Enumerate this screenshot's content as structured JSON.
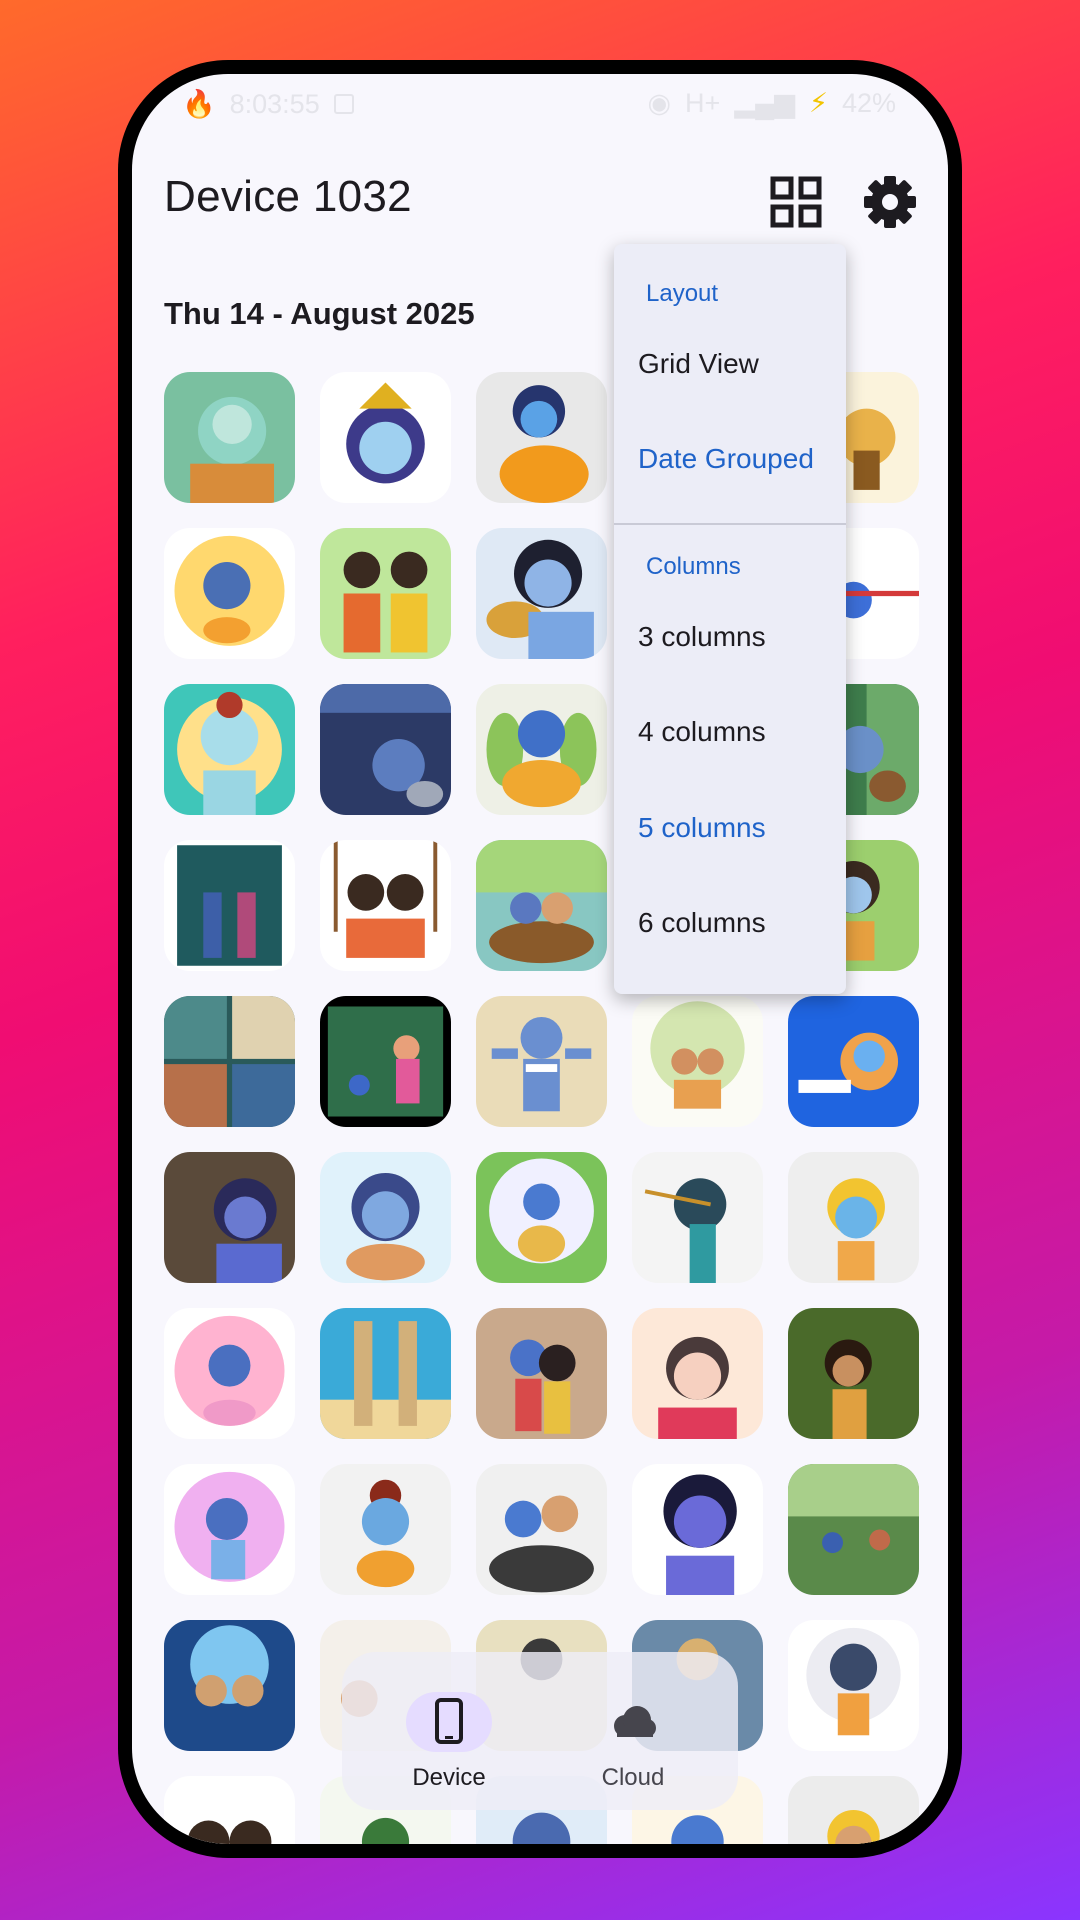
{
  "status_bar": {
    "time": "8:03:55",
    "network": "H+",
    "battery": "42%",
    "icons": [
      "fire-icon",
      "image-icon",
      "eye-icon",
      "signal-icon",
      "charging-bolt-icon"
    ]
  },
  "header": {
    "title": "Device 1032",
    "layout_button_icon": "grid-icon",
    "settings_button_icon": "gear-icon"
  },
  "section": {
    "date": "Thu 14 - August 2025"
  },
  "menu": {
    "layout_header": "Layout",
    "layout_items": [
      {
        "label": "Grid View",
        "selected": false
      },
      {
        "label": "Date Grouped",
        "selected": true
      }
    ],
    "columns_header": "Columns",
    "column_items": [
      {
        "label": "3 columns",
        "selected": false
      },
      {
        "label": "4 columns",
        "selected": false
      },
      {
        "label": "5 columns",
        "selected": true
      },
      {
        "label": "6 columns",
        "selected": false
      }
    ]
  },
  "bottom_nav": {
    "items": [
      {
        "label": "Device",
        "icon": "phone-icon",
        "active": true
      },
      {
        "label": "Cloud",
        "icon": "cloud-icon",
        "active": false
      }
    ]
  },
  "colors": {
    "accent": "#1f63c9",
    "nav_active_pill": "#e5dcff",
    "screen_bg": "#f8f7fd"
  }
}
